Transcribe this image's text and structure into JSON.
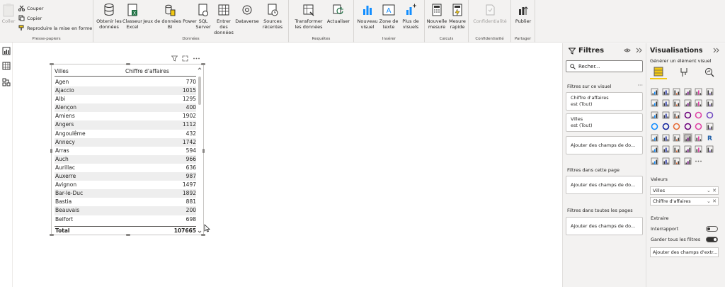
{
  "ribbon": {
    "clipboard": {
      "paste": "Coller",
      "cut": "Couper",
      "copy": "Copier",
      "format_painter": "Reproduire la mise en forme",
      "group": "Presse-papiers"
    },
    "data": {
      "get_data": "Obtenir les données",
      "excel": "Classeur Excel",
      "datasets": "Jeux de données Power BI",
      "sql": "SQL Server",
      "enter_data": "Entrer des données",
      "dataverse": "Dataverse",
      "recent": "Sources récentes",
      "group": "Données"
    },
    "queries": {
      "transform": "Transformer les données",
      "refresh": "Actualiser",
      "group": "Requêtes"
    },
    "insert": {
      "new_visual": "Nouveau visuel",
      "text_box": "Zone de texte",
      "more_visuals": "Plus de visuels",
      "group": "Insérer"
    },
    "calc": {
      "new_measure": "Nouvelle mesure",
      "quick_measure": "Mesure rapide",
      "group": "Calculs"
    },
    "sensitivity": {
      "label": "Confidentialité",
      "group": "Confidentialité"
    },
    "share": {
      "publish": "Publier",
      "group": "Partager"
    }
  },
  "table": {
    "header_city": "Villes",
    "header_amount": "Chiffre d'affaires",
    "rows": [
      {
        "city": "Agen",
        "amount": "770"
      },
      {
        "city": "Ajaccio",
        "amount": "1015"
      },
      {
        "city": "Albi",
        "amount": "1295"
      },
      {
        "city": "Alençon",
        "amount": "400"
      },
      {
        "city": "Amiens",
        "amount": "1902"
      },
      {
        "city": "Angers",
        "amount": "1112"
      },
      {
        "city": "Angoulême",
        "amount": "432"
      },
      {
        "city": "Annecy",
        "amount": "1742"
      },
      {
        "city": "Arras",
        "amount": "594"
      },
      {
        "city": "Auch",
        "amount": "966"
      },
      {
        "city": "Aurillac",
        "amount": "636"
      },
      {
        "city": "Auxerre",
        "amount": "987"
      },
      {
        "city": "Avignon",
        "amount": "1497"
      },
      {
        "city": "Bar-le-Duc",
        "amount": "1892"
      },
      {
        "city": "Bastia",
        "amount": "881"
      },
      {
        "city": "Beauvais",
        "amount": "200"
      },
      {
        "city": "Belfort",
        "amount": "698"
      }
    ],
    "total_label": "Total",
    "total_value": "107665"
  },
  "filters": {
    "title": "Filtres",
    "search_placeholder": "Recher...",
    "on_visual": "Filtres sur ce visuel",
    "card1_title": "Chiffre d'affaires",
    "card1_sub": "est (Tout)",
    "card2_title": "Villes",
    "card2_sub": "est (Tout)",
    "add_fields": "Ajouter des champs de do...",
    "on_page": "Filtres dans cette page",
    "on_all_pages": "Filtres dans toutes les pages"
  },
  "viz": {
    "title": "Visualisations",
    "build_visual": "Générer un élément visuel",
    "values_label": "Valeurs",
    "well_city": "Villes",
    "well_amount": "Chiffre d'affaires",
    "drill_label": "Extraire",
    "cross_report": "Interrapport",
    "keep_filters": "Garder tous les filtres",
    "drill_add": "Ajouter des champs d'extr..."
  },
  "colors": {
    "accent_yellow": "#f2c811",
    "excel_green": "#217346"
  }
}
